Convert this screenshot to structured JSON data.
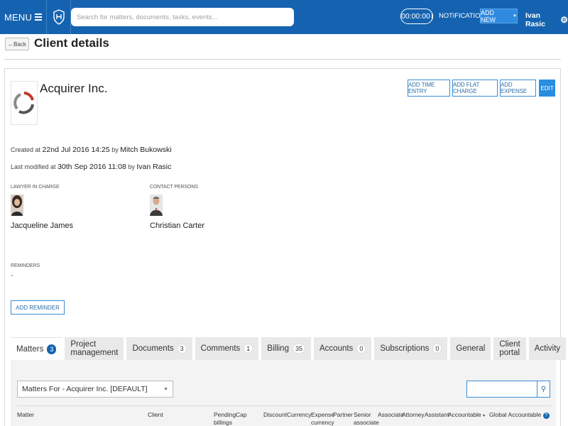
{
  "topbar": {
    "menu_label": "MENU",
    "search_placeholder": "Search for matters, documents, tasks, events...",
    "timer": "00:00:00",
    "notifications": "NOTIFICATIONS",
    "add_new": "ADD NEW",
    "user_name": "Ivan Rasic",
    "brand_color": "#1563b0"
  },
  "header": {
    "back_label": "←Back",
    "title": "Client details"
  },
  "client": {
    "name": "Acquirer Inc.",
    "actions": [
      "ADD TIME ENTRY",
      "ADD FLAT CHARGE",
      "ADD EXPENSE"
    ],
    "edit_label": "EDIT",
    "created_prefix": "Created at",
    "created_date": "22nd Jul 2016 14:25",
    "by": "by",
    "created_by": "Mitch Bukowski",
    "modified_prefix": "Last modified at",
    "modified_date": "30th Sep 2016 11:08",
    "modified_by": "Ivan Rasic",
    "lawyer_label": "LAWYER IN CHARGE",
    "lawyer_name": "Jacqueline James",
    "contact_label": "CONTACT PERSONS",
    "contact_name": "Christian Carter",
    "reminders_label": "REMINDERS",
    "reminders_value": "-",
    "add_reminder": "ADD REMINDER"
  },
  "tabs": [
    {
      "label": "Matters",
      "count": "3",
      "active": true
    },
    {
      "label": "Project management",
      "count": null
    },
    {
      "label": "Documents",
      "count": "3"
    },
    {
      "label": "Comments",
      "count": "1"
    },
    {
      "label": "Billing",
      "count": "35"
    },
    {
      "label": "Accounts",
      "count": "0"
    },
    {
      "label": "Subscriptions",
      "count": "0"
    },
    {
      "label": "General",
      "count": null
    },
    {
      "label": "Client portal",
      "count": null
    },
    {
      "label": "Activity",
      "count": null
    }
  ],
  "matters": {
    "filter_select": "Matters For - Acquirer Inc. [DEFAULT]",
    "columns": [
      "Matter",
      "Client",
      "Pending billings",
      "Cap",
      "Discount",
      "Currency",
      "Expense currency",
      "Partner",
      "Senior associate",
      "Associate",
      "Attorney",
      "Assistant",
      "Accountable",
      "Global Accountable"
    ]
  }
}
